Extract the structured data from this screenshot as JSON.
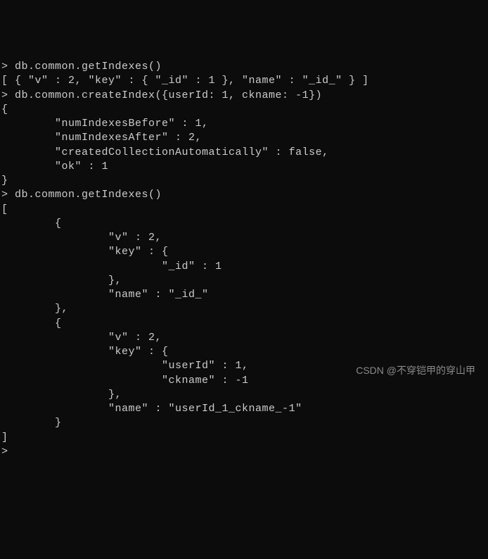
{
  "terminal": {
    "lines": [
      "> db.common.getIndexes()",
      "[ { \"v\" : 2, \"key\" : { \"_id\" : 1 }, \"name\" : \"_id_\" } ]",
      "> db.common.createIndex({userId: 1, ckname: -1})",
      "{",
      "        \"numIndexesBefore\" : 1,",
      "        \"numIndexesAfter\" : 2,",
      "        \"createdCollectionAutomatically\" : false,",
      "        \"ok\" : 1",
      "}",
      "> db.common.getIndexes()",
      "[",
      "        {",
      "                \"v\" : 2,",
      "                \"key\" : {",
      "                        \"_id\" : 1",
      "                },",
      "                \"name\" : \"_id_\"",
      "        },",
      "        {",
      "                \"v\" : 2,",
      "                \"key\" : {",
      "                        \"userId\" : 1,",
      "                        \"ckname\" : -1",
      "                },",
      "                \"name\" : \"userId_1_ckname_-1\"",
      "        }",
      "]",
      ">"
    ]
  },
  "watermark": {
    "text": "CSDN @不穿铠甲的穿山甲"
  }
}
